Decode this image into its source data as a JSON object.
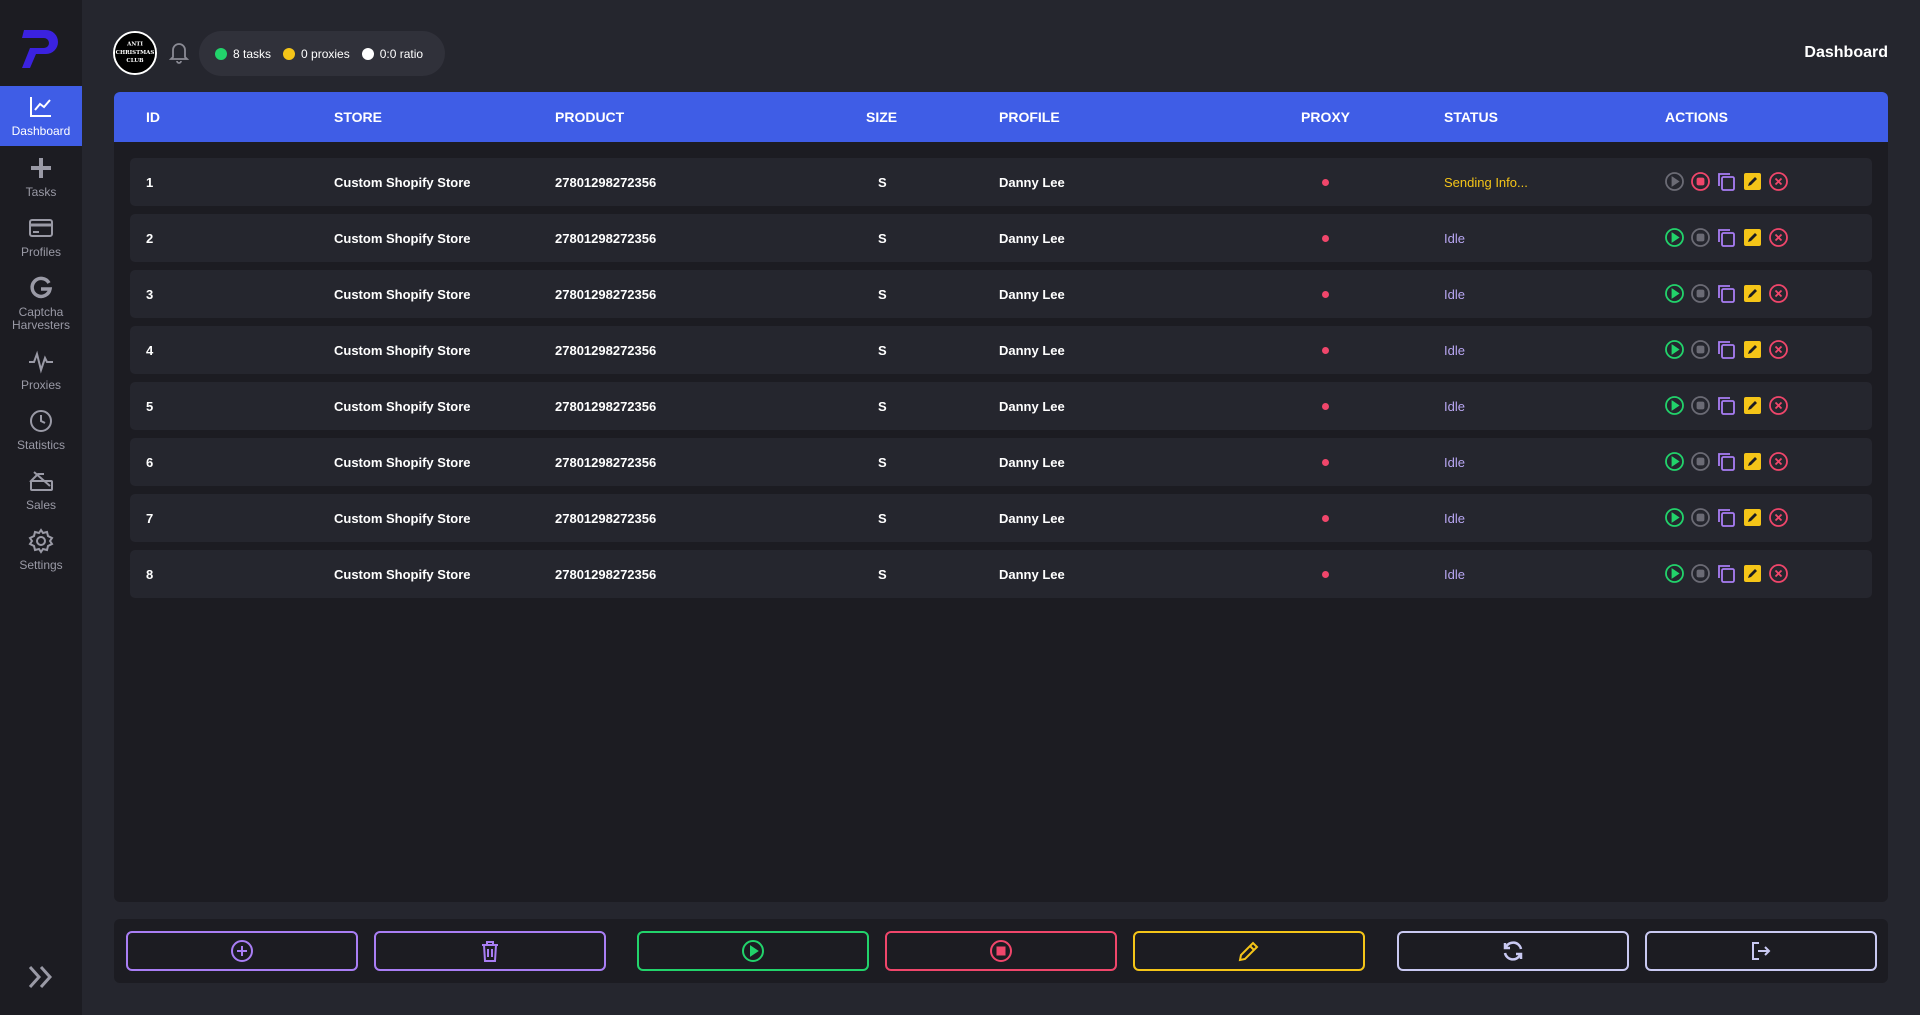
{
  "app": {
    "page_title": "Dashboard",
    "colors": {
      "accent": "#3f5de6",
      "success": "#22d36b",
      "danger": "#f0466b",
      "warning": "#f5c518",
      "purple": "#a97ef5",
      "muted": "#6b6b75"
    }
  },
  "sidebar": {
    "items": [
      {
        "label": "Dashboard",
        "icon": "chart-line-icon"
      },
      {
        "label": "Tasks",
        "icon": "plus-icon"
      },
      {
        "label": "Profiles",
        "icon": "credit-card-icon"
      },
      {
        "label": "Captcha Harvesters",
        "icon": "google-g-icon"
      },
      {
        "label": "Proxies",
        "icon": "pulse-icon"
      },
      {
        "label": "Statistics",
        "icon": "clock-icon"
      },
      {
        "label": "Sales",
        "icon": "sale-tag-icon"
      },
      {
        "label": "Settings",
        "icon": "gear-icon"
      }
    ]
  },
  "header": {
    "avatar_text": "ANTI CHRISTMAS CLUB",
    "stats": [
      {
        "label": "8 tasks",
        "color": "#22d36b"
      },
      {
        "label": "0 proxies",
        "color": "#f5c518"
      },
      {
        "label": "0:0 ratio",
        "color": "#ffffff"
      }
    ]
  },
  "table": {
    "columns": [
      "ID",
      "STORE",
      "PRODUCT",
      "SIZE",
      "PROFILE",
      "PROXY",
      "STATUS",
      "ACTIONS"
    ],
    "rows": [
      {
        "id": "1",
        "store": "Custom Shopify Store",
        "product": "27801298272356",
        "size": "S",
        "profile": "Danny Lee",
        "status": "Sending Info...",
        "running": true
      },
      {
        "id": "2",
        "store": "Custom Shopify Store",
        "product": "27801298272356",
        "size": "S",
        "profile": "Danny Lee",
        "status": "Idle",
        "running": false
      },
      {
        "id": "3",
        "store": "Custom Shopify Store",
        "product": "27801298272356",
        "size": "S",
        "profile": "Danny Lee",
        "status": "Idle",
        "running": false
      },
      {
        "id": "4",
        "store": "Custom Shopify Store",
        "product": "27801298272356",
        "size": "S",
        "profile": "Danny Lee",
        "status": "Idle",
        "running": false
      },
      {
        "id": "5",
        "store": "Custom Shopify Store",
        "product": "27801298272356",
        "size": "S",
        "profile": "Danny Lee",
        "status": "Idle",
        "running": false
      },
      {
        "id": "6",
        "store": "Custom Shopify Store",
        "product": "27801298272356",
        "size": "S",
        "profile": "Danny Lee",
        "status": "Idle",
        "running": false
      },
      {
        "id": "7",
        "store": "Custom Shopify Store",
        "product": "27801298272356",
        "size": "S",
        "profile": "Danny Lee",
        "status": "Idle",
        "running": false
      },
      {
        "id": "8",
        "store": "Custom Shopify Store",
        "product": "27801298272356",
        "size": "S",
        "profile": "Danny Lee",
        "status": "Idle",
        "running": false
      }
    ]
  },
  "bottom_bar": {
    "buttons": [
      {
        "name": "add-task-button",
        "icon": "plus-circle-icon",
        "color": "#a97ef5"
      },
      {
        "name": "delete-all-button",
        "icon": "trash-icon",
        "color": "#a97ef5"
      },
      {
        "name": "start-all-button",
        "icon": "play-circle-icon",
        "color": "#22d36b"
      },
      {
        "name": "stop-all-button",
        "icon": "stop-circle-icon",
        "color": "#f0466b"
      },
      {
        "name": "edit-all-button",
        "icon": "pencil-icon",
        "color": "#f5c518"
      },
      {
        "name": "refresh-button",
        "icon": "refresh-icon",
        "color": "#c9c9f2"
      },
      {
        "name": "logout-button",
        "icon": "sign-out-icon",
        "color": "#c9c9f2"
      }
    ]
  }
}
